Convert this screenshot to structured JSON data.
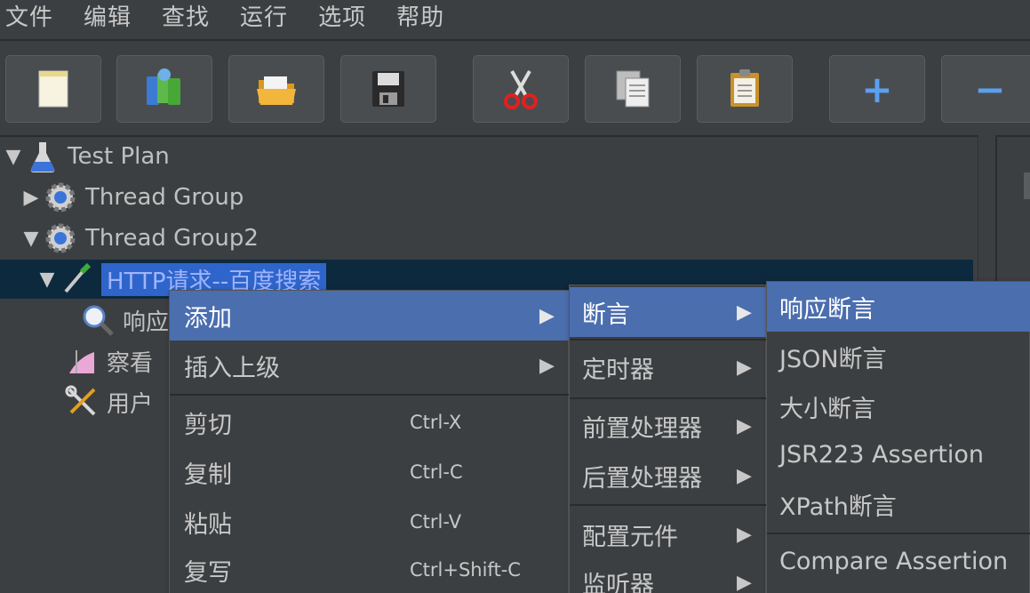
{
  "menubar": {
    "items": [
      "文件",
      "编辑",
      "查找",
      "运行",
      "选项",
      "帮助"
    ]
  },
  "toolbar": {
    "buttons": [
      "new-icon",
      "templates-icon",
      "open-icon",
      "save-icon",
      "cut-icon",
      "copy-icon",
      "paste-icon",
      "expand-icon",
      "collapse-icon"
    ],
    "expand_glyph": "+",
    "collapse_glyph": "−"
  },
  "tree": {
    "test_plan": "Test Plan",
    "thread_group": "Thread Group",
    "thread_group2": "Thread Group2",
    "http_request": "HTTP请求--百度搜索",
    "child_response": "响应",
    "child_view": "察看",
    "child_user": "用户"
  },
  "context_menu": {
    "add": "添加",
    "insert_parent": "插入上级",
    "cut": "剪切",
    "cut_shortcut": "Ctrl-X",
    "copy": "复制",
    "copy_shortcut": "Ctrl-C",
    "paste": "粘贴",
    "paste_shortcut": "Ctrl-V",
    "duplicate": "复写",
    "duplicate_shortcut": "Ctrl+Shift-C"
  },
  "add_submenu": {
    "assertion": "断言",
    "timer": "定时器",
    "pre_processor": "前置处理器",
    "post_processor": "后置处理器",
    "config_element": "配置元件",
    "listener": "监听器"
  },
  "assertion_submenu": {
    "response_assertion": "响应断言",
    "json_assertion": "JSON断言",
    "size_assertion": "大小断言",
    "jsr223_assertion": "JSR223 Assertion",
    "xpath_assertion": "XPath断言",
    "compare_assertion": "Compare Assertion"
  },
  "colors": {
    "background": "#3c3f41",
    "menu_highlight": "#4b6eaf",
    "tree_selection": "#2f65ca"
  }
}
